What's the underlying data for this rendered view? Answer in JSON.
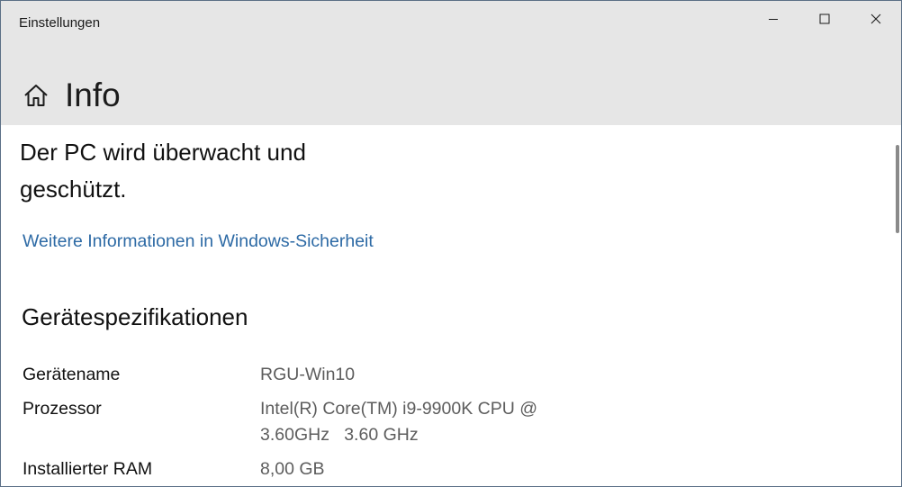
{
  "window": {
    "title": "Einstellungen",
    "controls": {
      "minimize": "minimize-icon",
      "maximize": "maximize-icon",
      "close": "close-icon"
    }
  },
  "header": {
    "icon": "home-icon",
    "title": "Info"
  },
  "protection": {
    "status": "Der PC wird überwacht und geschützt.",
    "link": "Weitere Informationen in Windows-Sicherheit"
  },
  "specs": {
    "title": "Gerätespezifikationen",
    "rows": [
      {
        "label": "Gerätename",
        "value": "RGU-Win10"
      },
      {
        "label": "Prozessor",
        "value": "Intel(R) Core(TM) i9-9900K CPU @ 3.60GHz   3.60 GHz"
      },
      {
        "label": "Installierter RAM",
        "value": "8,00 GB"
      }
    ]
  },
  "colors": {
    "header_bg": "#e6e6e6",
    "link": "#2d6aa5",
    "value_text": "#5d5d5d"
  }
}
